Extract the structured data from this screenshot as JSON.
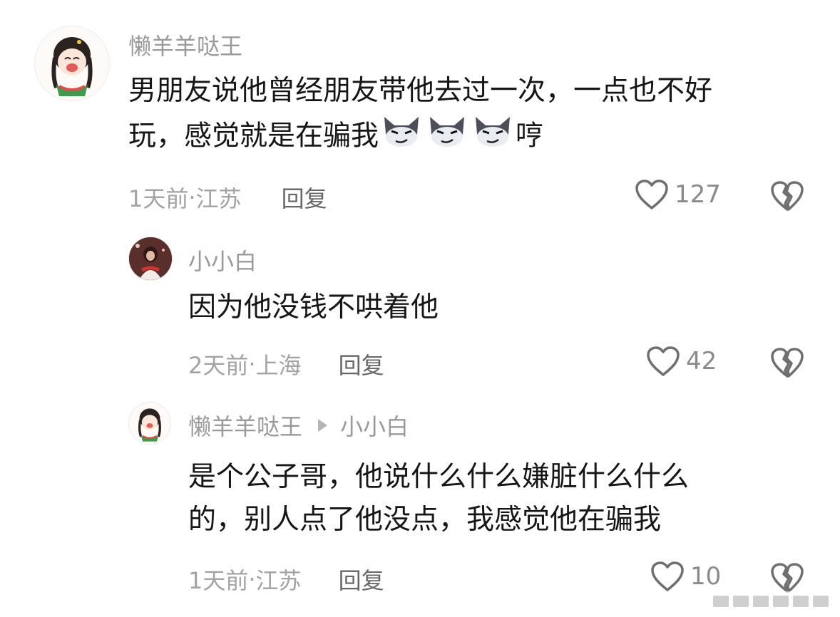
{
  "comments": [
    {
      "username": "懒羊羊哒王",
      "text_line1": "男朋友说他曾经朋友带他去过一次，一点也不好",
      "text_line2_a": "玩，感觉就是在骗我",
      "text_line2_b": "哼",
      "time": "1天前",
      "location": "江苏",
      "reply": "回复",
      "likes": "127",
      "emoji_icon": "wolf-smirk-emoji"
    }
  ],
  "replies": [
    {
      "username": "小小白",
      "text": "因为他没钱不哄着他",
      "time": "2天前",
      "location": "上海",
      "reply": "回复",
      "likes": "42"
    },
    {
      "username": "懒羊羊哒王",
      "reply_to": "小小白",
      "text_line1": "是个公子哥，他说什么什么嫌脏什么什么",
      "text_line2": "的，别人点了他没点，我感觉他在骗我",
      "time": "1天前",
      "location": "江苏",
      "reply": "回复",
      "likes": "10"
    }
  ],
  "separator": " · ",
  "colors": {
    "text": "#161616",
    "meta": "#a3a3a3",
    "name": "#9a9a9a",
    "icon": "#6f6f6f"
  }
}
